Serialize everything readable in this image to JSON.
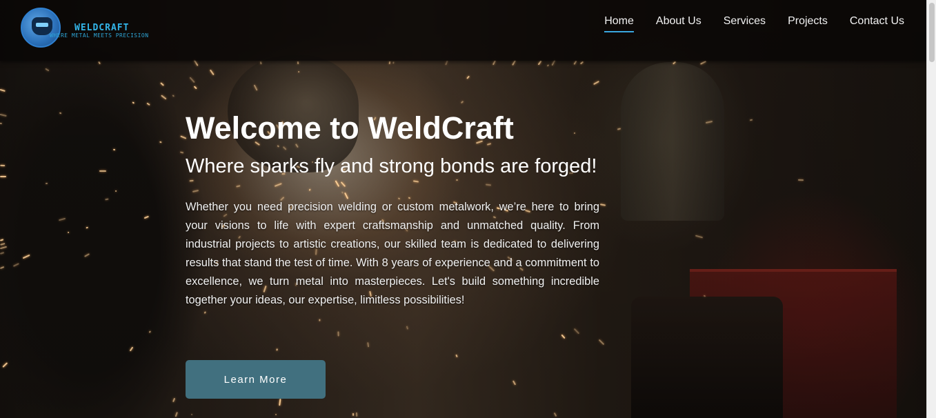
{
  "brand": {
    "name": "WELDCRAFT",
    "tagline": "WHERE METAL MEETS PRECISION",
    "color": "#33b6ea"
  },
  "nav": {
    "items": [
      {
        "label": "Home",
        "active": true
      },
      {
        "label": "About Us",
        "active": false
      },
      {
        "label": "Services",
        "active": false
      },
      {
        "label": "Projects",
        "active": false
      },
      {
        "label": "Contact Us",
        "active": false
      }
    ],
    "active_color": "#3aa8e0"
  },
  "hero": {
    "title": "Welcome to WeldCraft",
    "subtitle": "Where sparks fly and strong bonds are forged!",
    "description": "Whether you need precision welding or custom metalwork, we’re here to bring your visions to life with expert craftsmanship and unmatched quality. From industrial projects to artistic creations, our skilled team is dedicated to delivering results that stand the test of time. With 8 years of experience and a commitment to excellence, we turn metal into masterpieces. Let's build something incredible together your ideas, our expertise, limitless possibilities!",
    "cta_label": "Learn More",
    "cta_color": "#41707f"
  }
}
